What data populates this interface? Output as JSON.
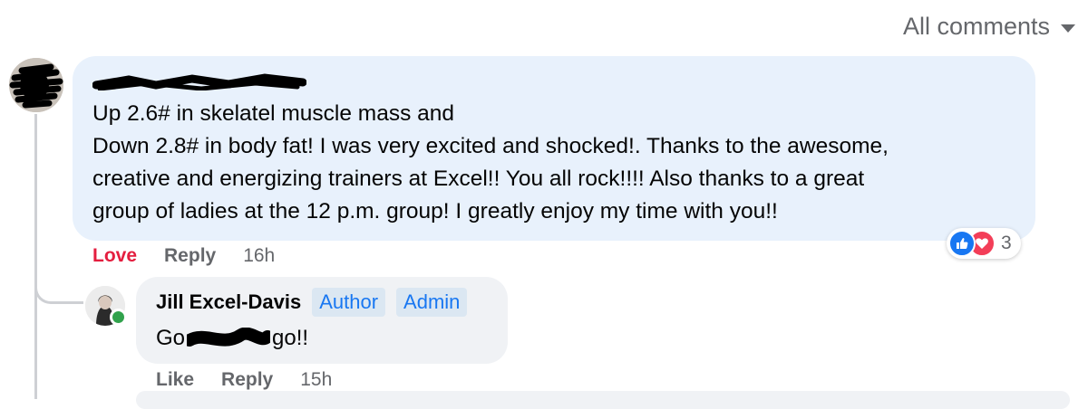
{
  "filter": {
    "label": "All comments",
    "icon": "caret-down-icon"
  },
  "comment": {
    "lines": [
      "Up 2.6# in skelatel muscle mass and",
      "Down 2.8# in body fat! I was very excited and shocked!. Thanks to the awesome,",
      "creative and energizing trainers at Excel!! You all rock!!!! Also thanks to a great",
      "group of ladies at the 12 p.m. group! I greatly enjoy my time with you!!"
    ],
    "actions": {
      "love": "Love",
      "reply": "Reply",
      "time": "16h"
    },
    "reactions": {
      "count": "3",
      "types": [
        "like-icon",
        "love-icon"
      ]
    }
  },
  "reply": {
    "author": "Jill Excel-Davis",
    "badges": [
      "Author",
      "Admin"
    ],
    "text_before": "Go",
    "text_after": "go!!",
    "actions": {
      "like": "Like",
      "reply": "Reply",
      "time": "15h"
    }
  },
  "colors": {
    "bubble_main": "#e8f1fc",
    "bubble_reply": "#f0f2f5",
    "love_red": "#e41e3f",
    "link_blue": "#1877f2",
    "muted_text": "#65676b"
  }
}
